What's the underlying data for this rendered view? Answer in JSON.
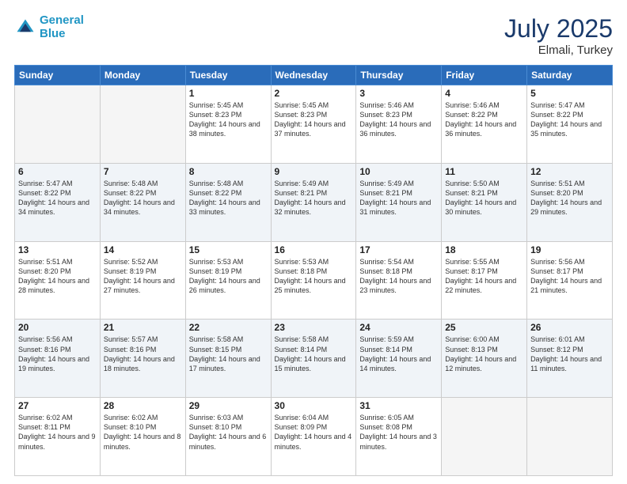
{
  "header": {
    "logo_line1": "General",
    "logo_line2": "Blue",
    "month_year": "July 2025",
    "location": "Elmali, Turkey"
  },
  "weekdays": [
    "Sunday",
    "Monday",
    "Tuesday",
    "Wednesday",
    "Thursday",
    "Friday",
    "Saturday"
  ],
  "weeks": [
    [
      {
        "day": "",
        "empty": true
      },
      {
        "day": "",
        "empty": true
      },
      {
        "day": "1",
        "sunrise": "5:45 AM",
        "sunset": "8:23 PM",
        "daylight": "14 hours and 38 minutes."
      },
      {
        "day": "2",
        "sunrise": "5:45 AM",
        "sunset": "8:23 PM",
        "daylight": "14 hours and 37 minutes."
      },
      {
        "day": "3",
        "sunrise": "5:46 AM",
        "sunset": "8:23 PM",
        "daylight": "14 hours and 36 minutes."
      },
      {
        "day": "4",
        "sunrise": "5:46 AM",
        "sunset": "8:22 PM",
        "daylight": "14 hours and 36 minutes."
      },
      {
        "day": "5",
        "sunrise": "5:47 AM",
        "sunset": "8:22 PM",
        "daylight": "14 hours and 35 minutes."
      }
    ],
    [
      {
        "day": "6",
        "sunrise": "5:47 AM",
        "sunset": "8:22 PM",
        "daylight": "14 hours and 34 minutes."
      },
      {
        "day": "7",
        "sunrise": "5:48 AM",
        "sunset": "8:22 PM",
        "daylight": "14 hours and 34 minutes."
      },
      {
        "day": "8",
        "sunrise": "5:48 AM",
        "sunset": "8:22 PM",
        "daylight": "14 hours and 33 minutes."
      },
      {
        "day": "9",
        "sunrise": "5:49 AM",
        "sunset": "8:21 PM",
        "daylight": "14 hours and 32 minutes."
      },
      {
        "day": "10",
        "sunrise": "5:49 AM",
        "sunset": "8:21 PM",
        "daylight": "14 hours and 31 minutes."
      },
      {
        "day": "11",
        "sunrise": "5:50 AM",
        "sunset": "8:21 PM",
        "daylight": "14 hours and 30 minutes."
      },
      {
        "day": "12",
        "sunrise": "5:51 AM",
        "sunset": "8:20 PM",
        "daylight": "14 hours and 29 minutes."
      }
    ],
    [
      {
        "day": "13",
        "sunrise": "5:51 AM",
        "sunset": "8:20 PM",
        "daylight": "14 hours and 28 minutes."
      },
      {
        "day": "14",
        "sunrise": "5:52 AM",
        "sunset": "8:19 PM",
        "daylight": "14 hours and 27 minutes."
      },
      {
        "day": "15",
        "sunrise": "5:53 AM",
        "sunset": "8:19 PM",
        "daylight": "14 hours and 26 minutes."
      },
      {
        "day": "16",
        "sunrise": "5:53 AM",
        "sunset": "8:18 PM",
        "daylight": "14 hours and 25 minutes."
      },
      {
        "day": "17",
        "sunrise": "5:54 AM",
        "sunset": "8:18 PM",
        "daylight": "14 hours and 23 minutes."
      },
      {
        "day": "18",
        "sunrise": "5:55 AM",
        "sunset": "8:17 PM",
        "daylight": "14 hours and 22 minutes."
      },
      {
        "day": "19",
        "sunrise": "5:56 AM",
        "sunset": "8:17 PM",
        "daylight": "14 hours and 21 minutes."
      }
    ],
    [
      {
        "day": "20",
        "sunrise": "5:56 AM",
        "sunset": "8:16 PM",
        "daylight": "14 hours and 19 minutes."
      },
      {
        "day": "21",
        "sunrise": "5:57 AM",
        "sunset": "8:16 PM",
        "daylight": "14 hours and 18 minutes."
      },
      {
        "day": "22",
        "sunrise": "5:58 AM",
        "sunset": "8:15 PM",
        "daylight": "14 hours and 17 minutes."
      },
      {
        "day": "23",
        "sunrise": "5:58 AM",
        "sunset": "8:14 PM",
        "daylight": "14 hours and 15 minutes."
      },
      {
        "day": "24",
        "sunrise": "5:59 AM",
        "sunset": "8:14 PM",
        "daylight": "14 hours and 14 minutes."
      },
      {
        "day": "25",
        "sunrise": "6:00 AM",
        "sunset": "8:13 PM",
        "daylight": "14 hours and 12 minutes."
      },
      {
        "day": "26",
        "sunrise": "6:01 AM",
        "sunset": "8:12 PM",
        "daylight": "14 hours and 11 minutes."
      }
    ],
    [
      {
        "day": "27",
        "sunrise": "6:02 AM",
        "sunset": "8:11 PM",
        "daylight": "14 hours and 9 minutes."
      },
      {
        "day": "28",
        "sunrise": "6:02 AM",
        "sunset": "8:10 PM",
        "daylight": "14 hours and 8 minutes."
      },
      {
        "day": "29",
        "sunrise": "6:03 AM",
        "sunset": "8:10 PM",
        "daylight": "14 hours and 6 minutes."
      },
      {
        "day": "30",
        "sunrise": "6:04 AM",
        "sunset": "8:09 PM",
        "daylight": "14 hours and 4 minutes."
      },
      {
        "day": "31",
        "sunrise": "6:05 AM",
        "sunset": "8:08 PM",
        "daylight": "14 hours and 3 minutes."
      },
      {
        "day": "",
        "empty": true
      },
      {
        "day": "",
        "empty": true
      }
    ]
  ]
}
